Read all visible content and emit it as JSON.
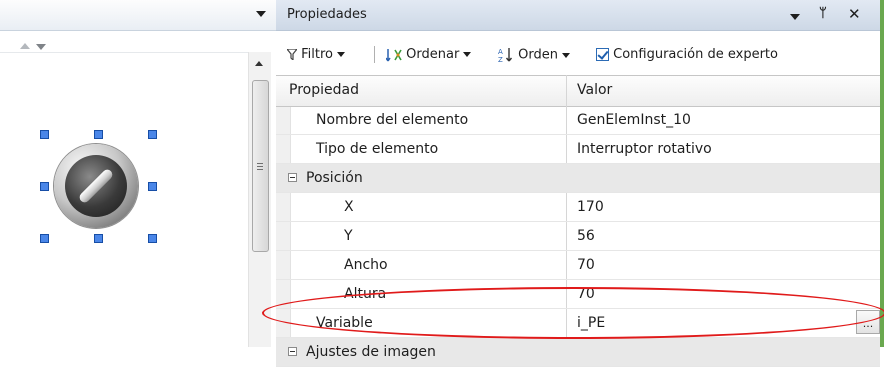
{
  "left_pane": {},
  "properties": {
    "title": "Propiedades",
    "pin": "ؤ",
    "close": "✕",
    "toolbar": {
      "filter_label": "Filtro",
      "sort_label": "Ordenar",
      "order_label": "Orden",
      "expert_label": "Configuración de experto",
      "expert_checked": true
    },
    "grid": {
      "col_property": "Propiedad",
      "col_value": "Valor",
      "rows": [
        {
          "name": "Nombre del elemento",
          "value": "GenElemInst_10"
        },
        {
          "name": "Tipo de elemento",
          "value": "Interruptor rotativo"
        },
        {
          "name": "Posición",
          "value": "",
          "category": true
        },
        {
          "name": "X",
          "value": "170"
        },
        {
          "name": "Y",
          "value": "56"
        },
        {
          "name": "Ancho",
          "value": "70"
        },
        {
          "name": "Altura",
          "value": "70"
        },
        {
          "name": "Variable",
          "value": "i_PE",
          "button": "..."
        },
        {
          "name": "Ajustes de imagen",
          "value": "",
          "category": true
        }
      ]
    }
  },
  "colors": {
    "selection_handle": "#4a86e8",
    "highlight_oval": "#e01a1a",
    "panel_border": "#6aa84f"
  }
}
